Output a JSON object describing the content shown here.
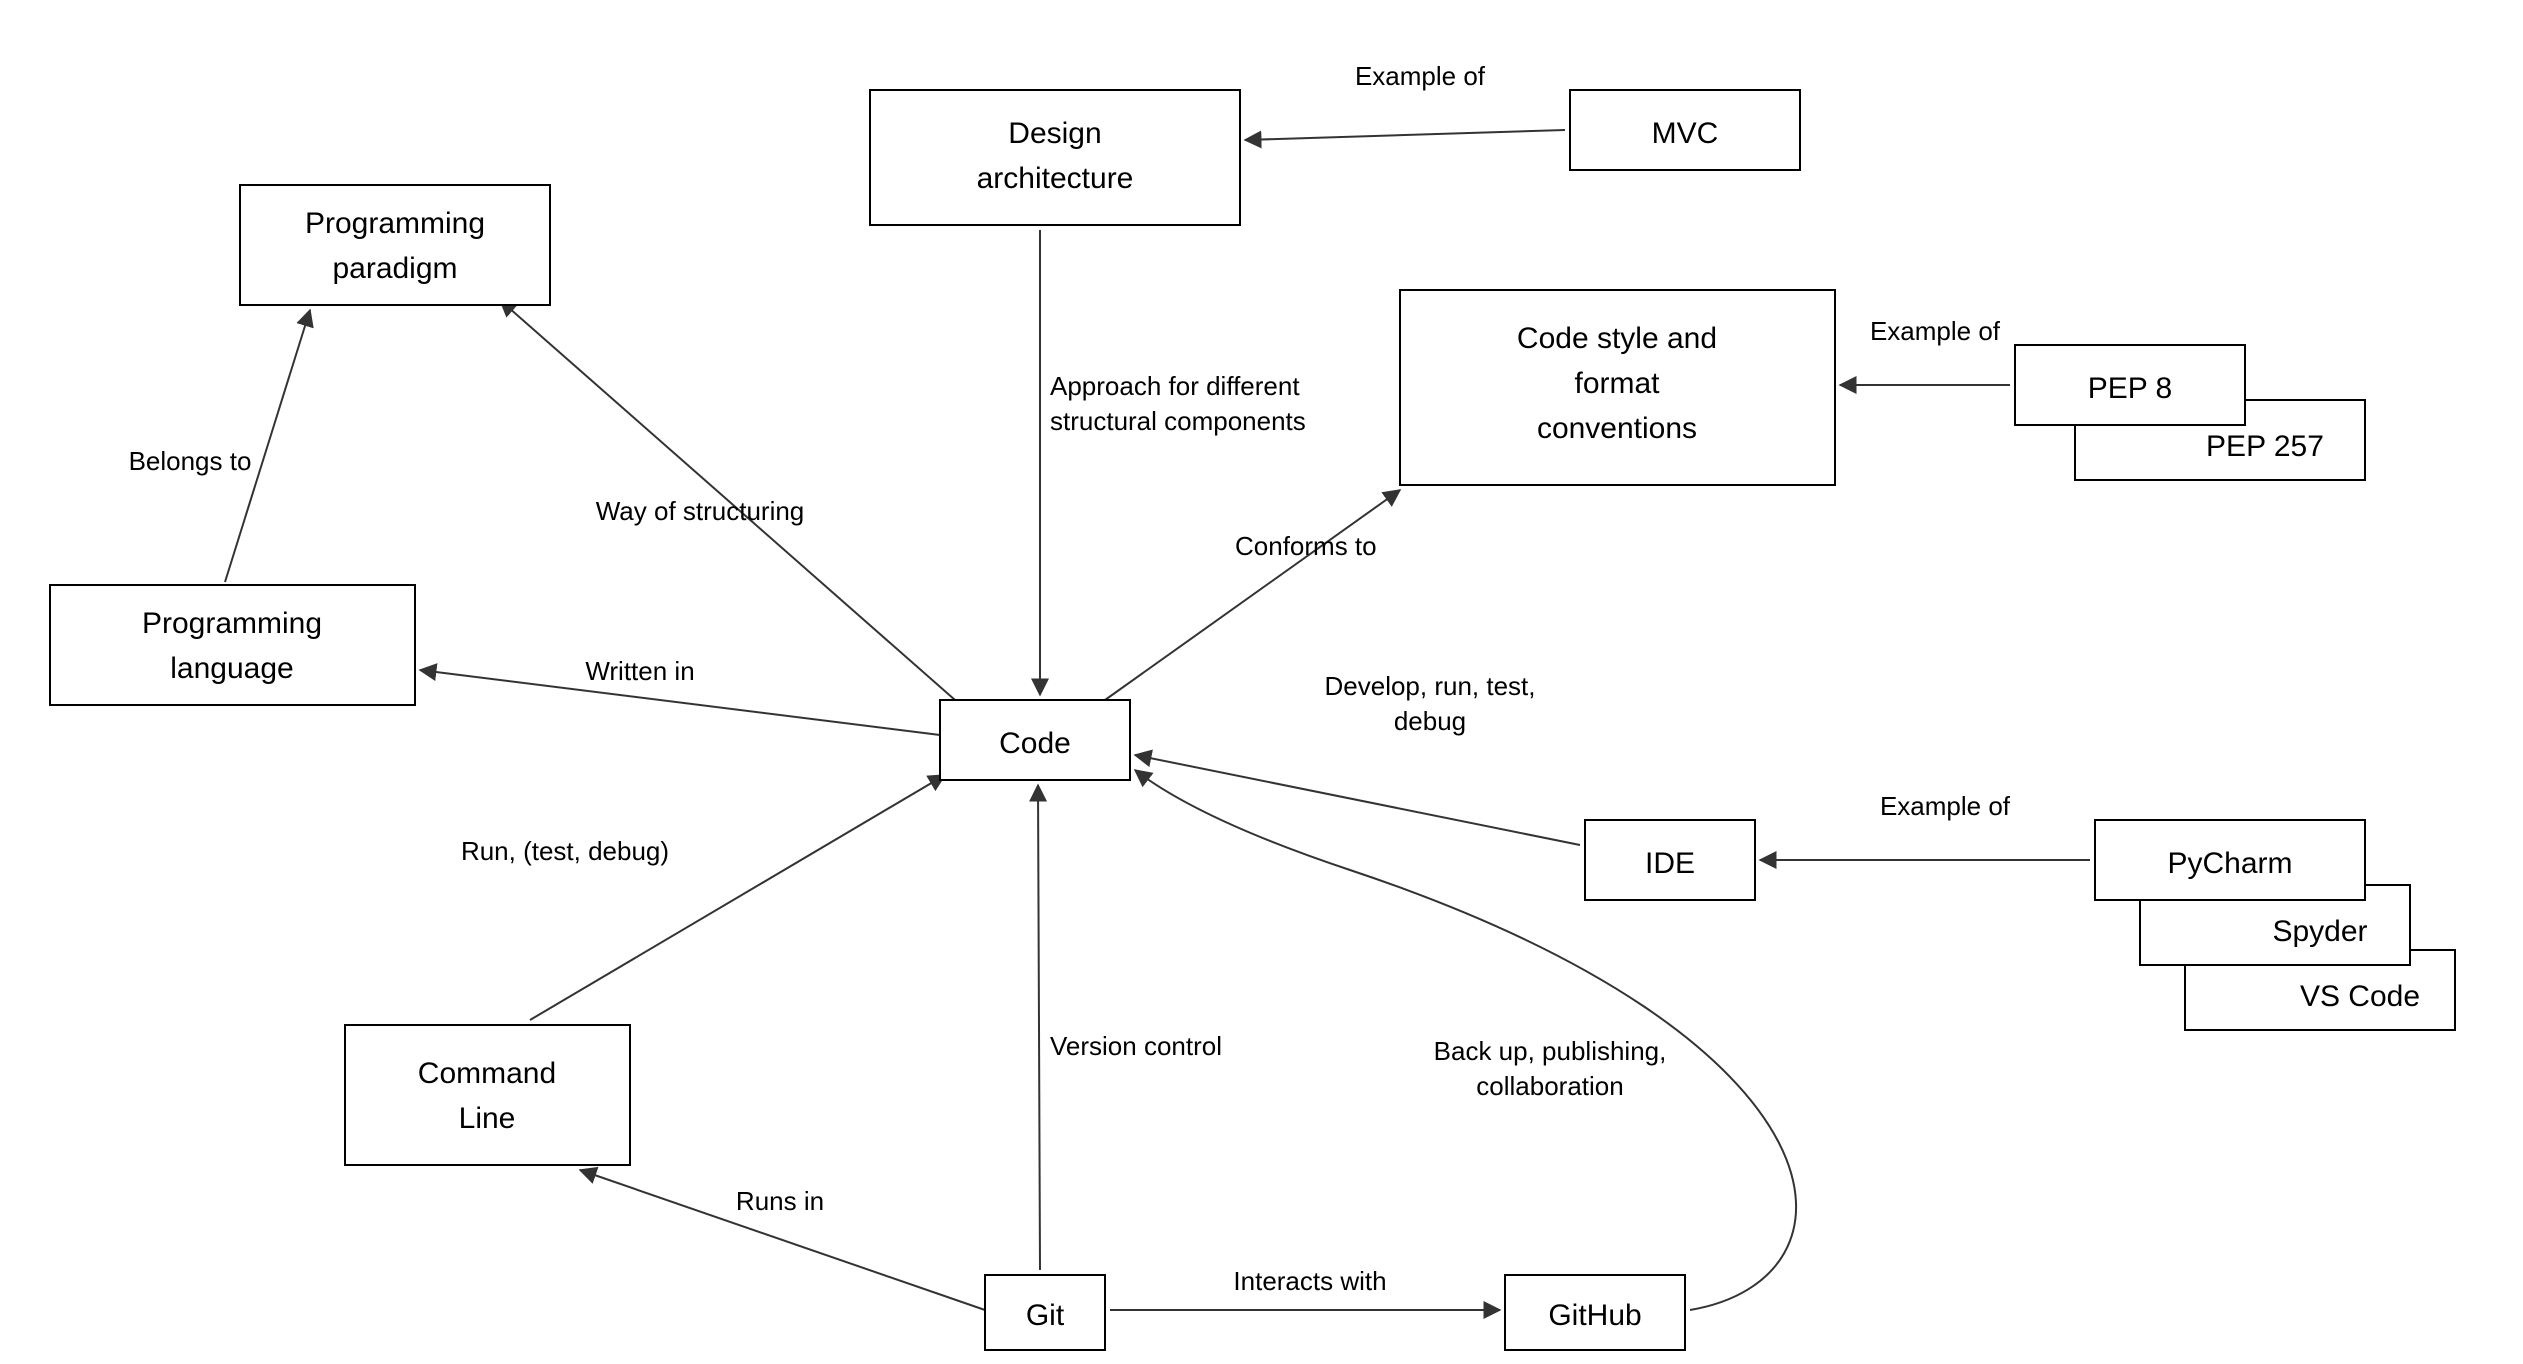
{
  "nodes": {
    "programming_paradigm": {
      "label_l1": "Programming",
      "label_l2": "paradigm"
    },
    "programming_language": {
      "label_l1": "Programming",
      "label_l2": "language"
    },
    "design_architecture": {
      "label_l1": "Design",
      "label_l2": "architecture"
    },
    "mvc": {
      "label": "MVC"
    },
    "code_style": {
      "label_l1": "Code style and",
      "label_l2": "format",
      "label_l3": "conventions"
    },
    "pep8": {
      "label": "PEP 8"
    },
    "pep257": {
      "label": "PEP 257"
    },
    "code": {
      "label": "Code"
    },
    "ide": {
      "label": "IDE"
    },
    "pycharm": {
      "label": "PyCharm"
    },
    "spyder": {
      "label": "Spyder"
    },
    "vscode": {
      "label": "VS Code"
    },
    "command_line": {
      "label_l1": "Command",
      "label_l2": "Line"
    },
    "git": {
      "label": "Git"
    },
    "github": {
      "label": "GitHub"
    }
  },
  "edges": {
    "belongs_to": {
      "label": "Belongs to"
    },
    "way_of_structuring": {
      "label": "Way of structuring"
    },
    "written_in": {
      "label": "Written in"
    },
    "run_test_debug": {
      "label": "Run, (test, debug)"
    },
    "approach_l1": {
      "label": "Approach for different"
    },
    "approach_l2": {
      "label": "structural components"
    },
    "conforms_to": {
      "label": "Conforms to"
    },
    "develop_l1": {
      "label": "Develop, run, test,"
    },
    "develop_l2": {
      "label": "debug"
    },
    "example_of_mvc": {
      "label": "Example of"
    },
    "example_of_pep": {
      "label": "Example of"
    },
    "example_of_ide": {
      "label": "Example of"
    },
    "version_control": {
      "label": "Version control"
    },
    "runs_in": {
      "label": "Runs in"
    },
    "interacts_with": {
      "label": "Interacts with"
    },
    "backup_l1": {
      "label": "Back up, publishing,"
    },
    "backup_l2": {
      "label": "collaboration"
    }
  }
}
